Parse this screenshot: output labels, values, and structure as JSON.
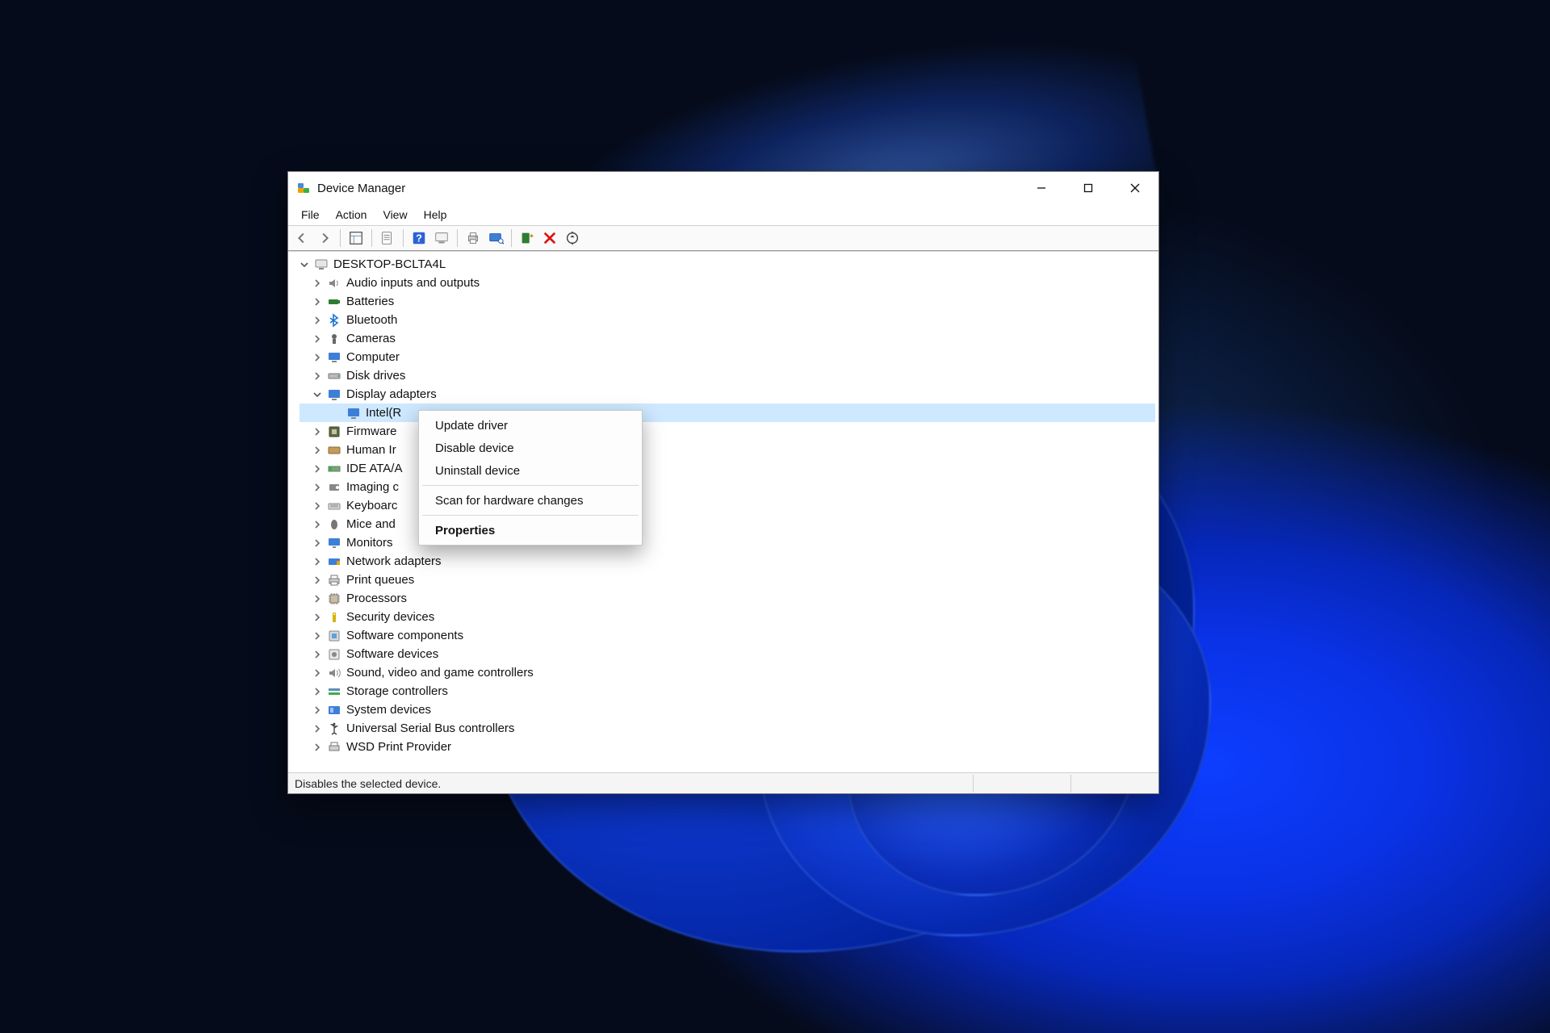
{
  "window": {
    "title": "Device Manager"
  },
  "menus": {
    "file": "File",
    "action": "Action",
    "view": "View",
    "help": "Help"
  },
  "toolbar_icons": {
    "back": "back-arrow-icon",
    "forward": "forward-arrow-icon",
    "show_hide": "show-hide-tree-icon",
    "properties_sheet": "properties-sheet-icon",
    "help": "help-icon",
    "action": "action-computer-icon",
    "print": "print-icon",
    "scan": "scan-hardware-icon",
    "add": "add-legacy-icon",
    "remove": "remove-device-icon",
    "update": "update-driver-icon"
  },
  "tree": {
    "root": "DESKTOP-BCLTA4L",
    "categories": [
      {
        "label": "Audio inputs and outputs",
        "icon": "audio-icon"
      },
      {
        "label": "Batteries",
        "icon": "battery-icon"
      },
      {
        "label": "Bluetooth",
        "icon": "bluetooth-icon"
      },
      {
        "label": "Cameras",
        "icon": "camera-icon"
      },
      {
        "label": "Computer",
        "icon": "computer-icon"
      },
      {
        "label": "Disk drives",
        "icon": "disk-drive-icon"
      },
      {
        "label": "Display adapters",
        "icon": "display-adapter-icon",
        "expanded": true,
        "children": [
          {
            "label": "Intel(R",
            "icon": "display-adapter-icon",
            "selected": true
          }
        ]
      },
      {
        "label": "Firmware",
        "icon": "firmware-icon",
        "truncated": true
      },
      {
        "label": "Human Ir",
        "icon": "hid-icon",
        "truncated": true
      },
      {
        "label": "IDE ATA/A",
        "icon": "ide-icon",
        "truncated": true
      },
      {
        "label": "Imaging c",
        "icon": "imaging-icon",
        "truncated": true
      },
      {
        "label": "Keyboarc",
        "icon": "keyboard-icon",
        "truncated": true
      },
      {
        "label": "Mice and",
        "icon": "mouse-icon",
        "truncated": true
      },
      {
        "label": "Monitors",
        "icon": "monitor-icon"
      },
      {
        "label": "Network adapters",
        "icon": "network-icon"
      },
      {
        "label": "Print queues",
        "icon": "printer-icon"
      },
      {
        "label": "Processors",
        "icon": "processor-icon"
      },
      {
        "label": "Security devices",
        "icon": "security-icon"
      },
      {
        "label": "Software components",
        "icon": "software-component-icon"
      },
      {
        "label": "Software devices",
        "icon": "software-device-icon"
      },
      {
        "label": "Sound, video and game controllers",
        "icon": "sound-controller-icon"
      },
      {
        "label": "Storage controllers",
        "icon": "storage-controller-icon"
      },
      {
        "label": "System devices",
        "icon": "system-device-icon"
      },
      {
        "label": "Universal Serial Bus controllers",
        "icon": "usb-controller-icon"
      },
      {
        "label": "WSD Print Provider",
        "icon": "wsd-print-icon"
      }
    ]
  },
  "context_menu": {
    "items": [
      {
        "label": "Update driver"
      },
      {
        "label": "Disable device"
      },
      {
        "label": "Uninstall device"
      }
    ],
    "scan": "Scan for hardware changes",
    "properties": "Properties"
  },
  "statusbar": {
    "text": "Disables the selected device."
  }
}
